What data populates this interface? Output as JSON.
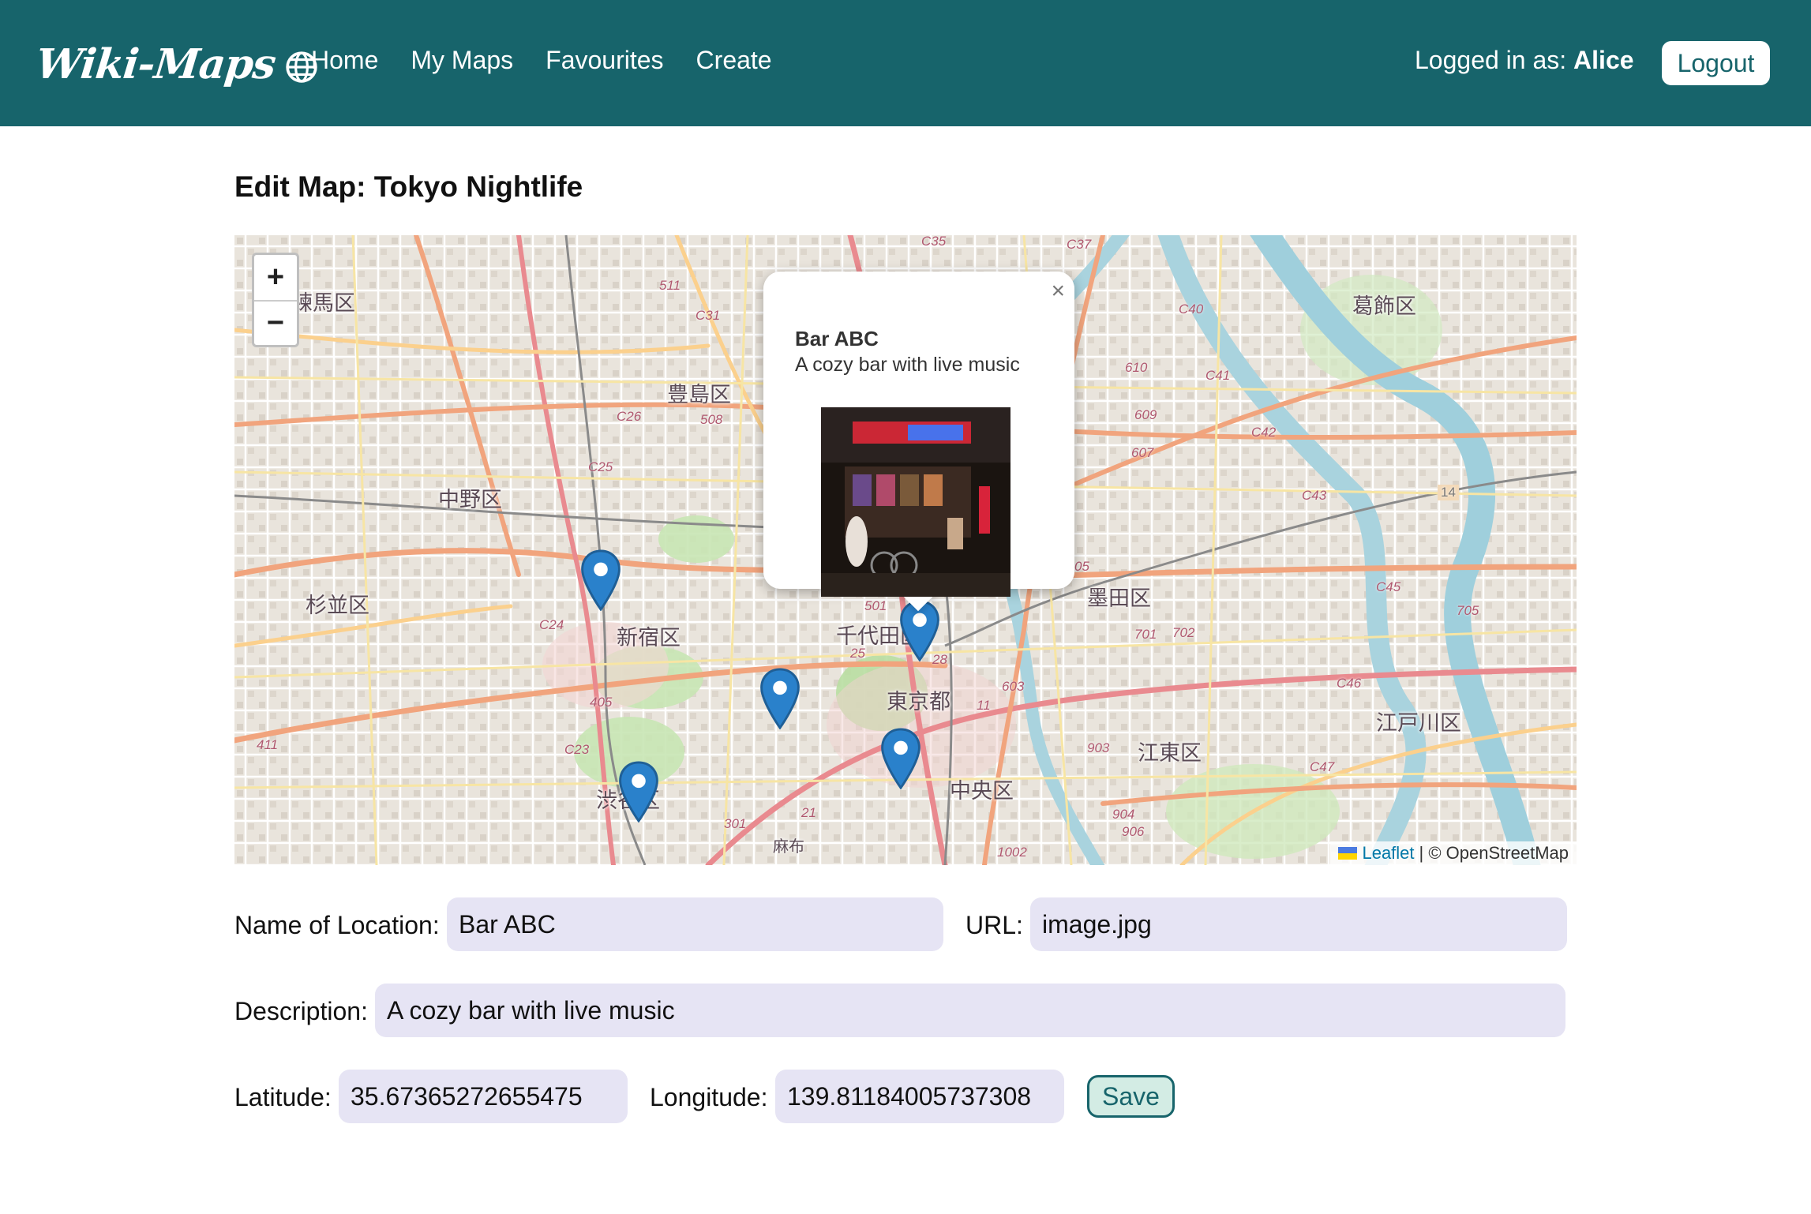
{
  "nav": {
    "brand": "Wiki-Maps",
    "links": [
      "Home",
      "My Maps",
      "Favourites",
      "Create"
    ],
    "login_prefix": "Logged in as:",
    "user_name": "Alice",
    "logout_label": "Logout"
  },
  "page": {
    "title": "Edit Map: Tokyo Nightlife"
  },
  "map": {
    "zoom_in": "+",
    "zoom_out": "−",
    "district_labels": [
      "練馬区",
      "豊島区",
      "中野区",
      "杉並区",
      "新宿区",
      "千代田区",
      "東京都",
      "葛飾区",
      "墨田区",
      "江戸川区",
      "江東区",
      "中央区",
      "渋谷区",
      "麻布"
    ],
    "road_numbers": [
      "C35",
      "C37",
      "511",
      "C31",
      "508",
      "C26",
      "C25",
      "C24",
      "405",
      "C23",
      "411",
      "301",
      "21",
      "501",
      "25",
      "28",
      "11",
      "603",
      "903",
      "904",
      "906",
      "1002",
      "610",
      "609",
      "607",
      "C40",
      "C41",
      "C42",
      "C43",
      "14",
      "C45",
      "705",
      "C46",
      "C47",
      "701",
      "702",
      "05"
    ],
    "marker_count": 5,
    "attribution_link": "Leaflet",
    "attribution_text": "| © OpenStreetMap",
    "popup": {
      "title": "Bar ABC",
      "description": "A cozy bar with live music",
      "close": "×"
    }
  },
  "form": {
    "name_label": "Name of Location:",
    "name_value": "Bar ABC",
    "url_label": "URL:",
    "url_value": "image.jpg",
    "description_label": "Description:",
    "description_value": "A cozy bar with live music",
    "latitude_label": "Latitude:",
    "latitude_value": "35.67365272655475",
    "longitude_label": "Longitude:",
    "longitude_value": "139.81184005737308",
    "save_label": "Save"
  },
  "colors": {
    "navbar": "#17646b",
    "input_bg": "#e6e4f4",
    "marker": "#2a81cb"
  }
}
